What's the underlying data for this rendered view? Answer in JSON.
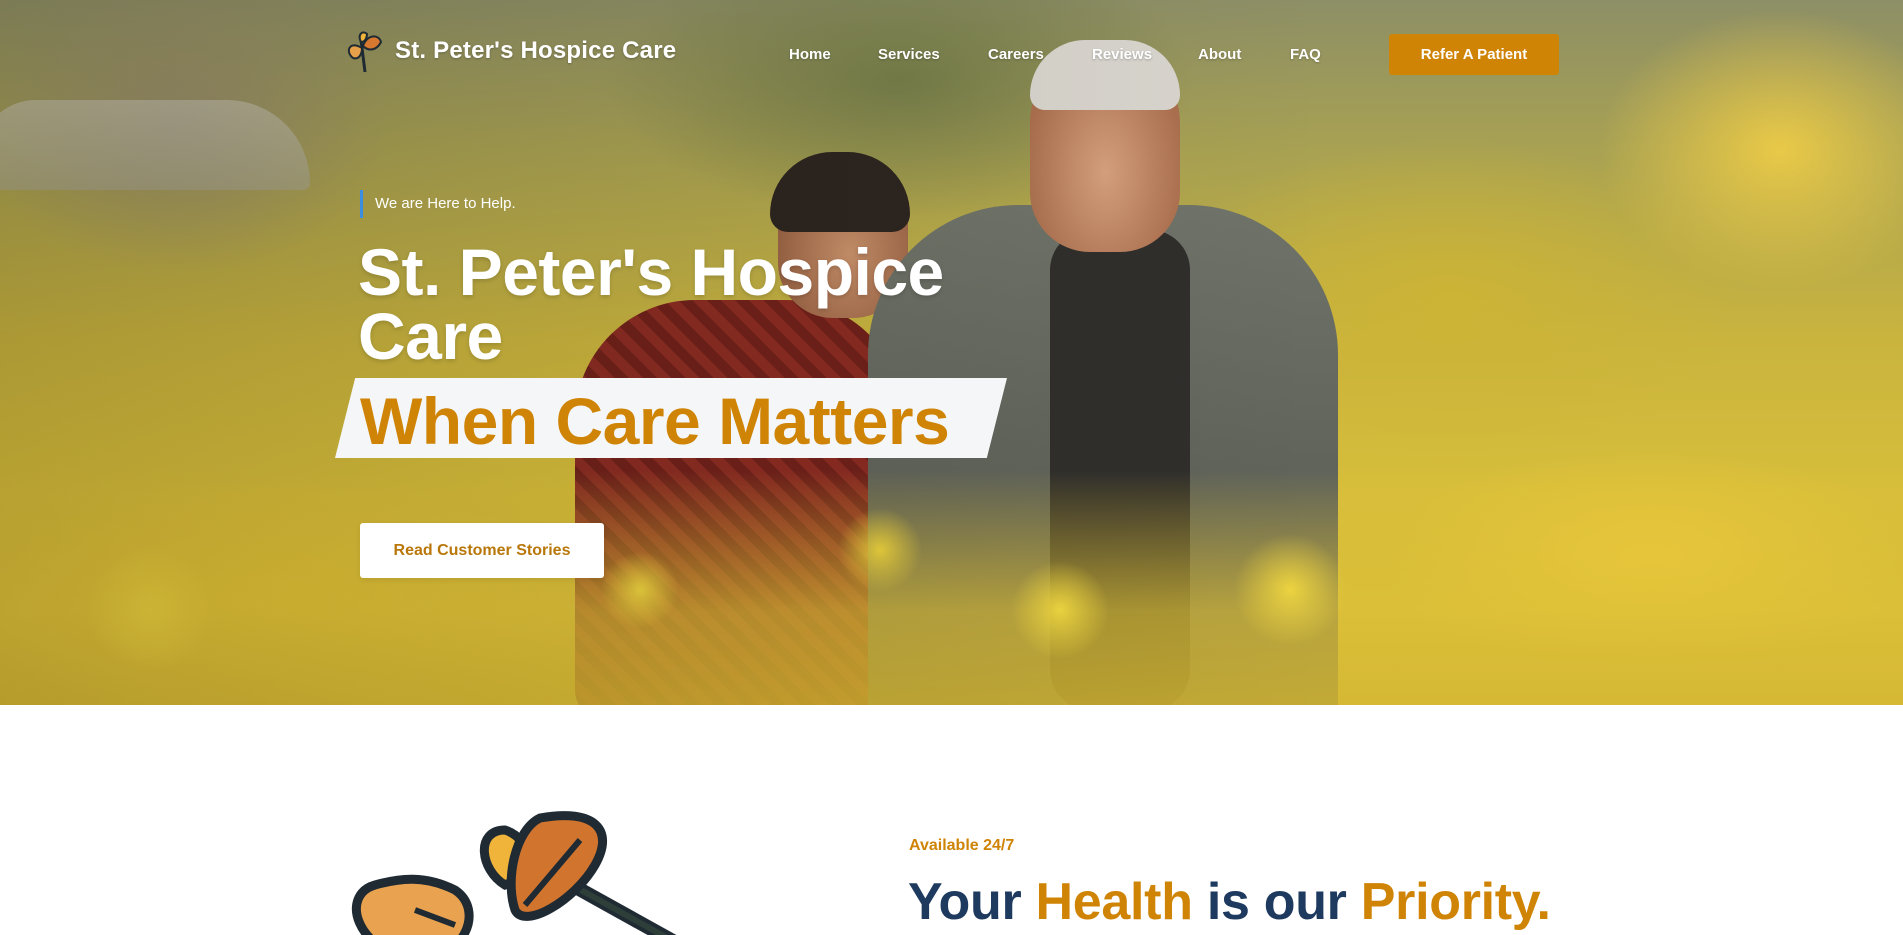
{
  "brand": {
    "name": "St. Peter's Hospice Care",
    "logo_icon": "leaf-logo-icon"
  },
  "nav": {
    "items": [
      {
        "label": "Home"
      },
      {
        "label": "Services"
      },
      {
        "label": "Careers"
      },
      {
        "label": "Reviews"
      },
      {
        "label": "About"
      },
      {
        "label": "FAQ"
      }
    ],
    "cta_label": "Refer A Patient"
  },
  "hero": {
    "eyebrow": "We are Here to Help.",
    "title": "St. Peter's Hospice Care",
    "tagline": "When Care Matters",
    "button_label": "Read Customer Stories"
  },
  "section": {
    "eyebrow": "Available 24/7",
    "heading_parts": [
      "Your",
      "Health",
      "is our",
      "Priority."
    ]
  },
  "colors": {
    "accent": "#cf8406",
    "navy": "#1e3a5f",
    "eyebrow_bar": "#3b8de0"
  }
}
